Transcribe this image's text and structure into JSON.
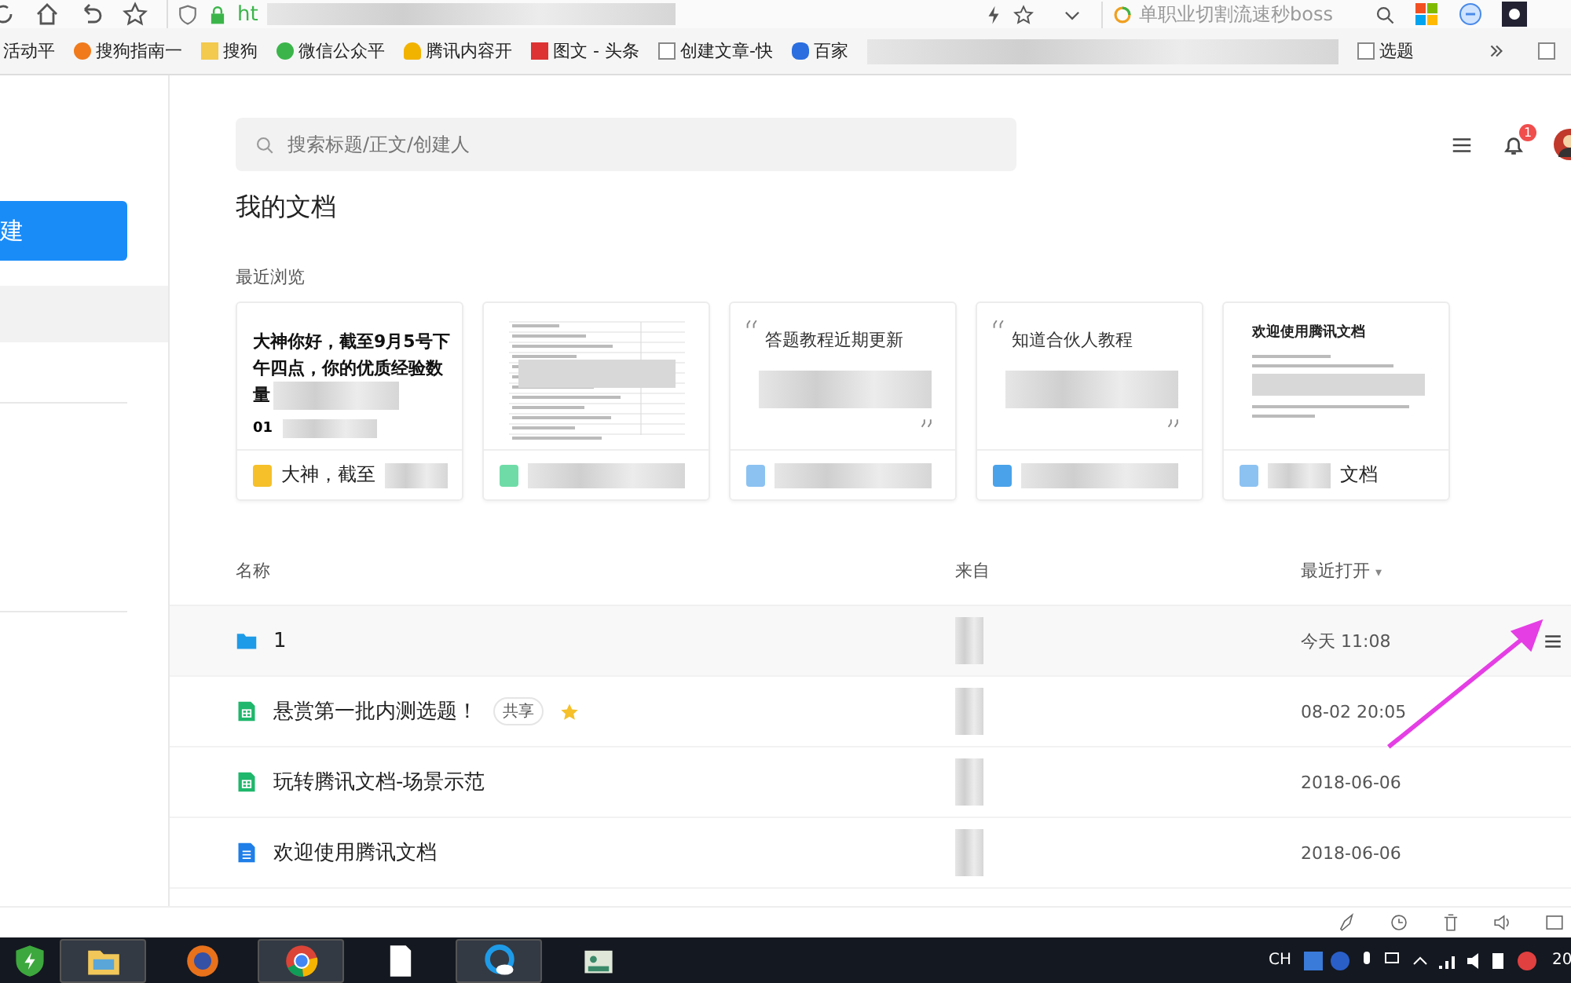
{
  "browser": {
    "url": "ht",
    "search": "单职业切割流速秒boss"
  },
  "bookmarks": [
    {
      "label": "活动平",
      "kind": "plain"
    },
    {
      "label": "搜狗指南一",
      "kind": "sogou"
    },
    {
      "label": "搜狗",
      "kind": "folder"
    },
    {
      "label": "微信公众平",
      "kind": "wechat"
    },
    {
      "label": "腾讯内容开",
      "kind": "bell"
    },
    {
      "label": "图文 - 头条",
      "kind": "toutiao"
    },
    {
      "label": "创建文章-快",
      "kind": "page"
    },
    {
      "label": "百家",
      "kind": "paw"
    },
    {
      "label": "选题",
      "kind": "page"
    }
  ],
  "sidebar": {
    "new_button": "建",
    "items": [
      {
        "selected": true
      }
    ]
  },
  "header": {
    "search_placeholder": "搜索标题/正文/创建人",
    "notification_count": "1"
  },
  "title": "我的文档",
  "recent": {
    "label": "最近浏览",
    "cards": [
      {
        "kind": "text",
        "preview_lines": [
          "大神你好，截至9月5号下",
          "午四点，你的优质经验数",
          "量"
        ],
        "footnote": "01",
        "name": "大神，截至",
        "color": "#f5c02a"
      },
      {
        "kind": "sheet",
        "color": "#6fdca8"
      },
      {
        "kind": "quote",
        "preview": "答题教程近期更新",
        "color": "#8cc2f2"
      },
      {
        "kind": "quote",
        "preview": "知道合伙人教程",
        "color": "#4aa2ea"
      },
      {
        "kind": "doc",
        "preview": "欢迎使用腾讯文档",
        "name": "文档",
        "color": "#8cc2f2"
      }
    ]
  },
  "table": {
    "columns": [
      "名称",
      "来自",
      "最近打开"
    ],
    "sort_indicator": "▾",
    "rows": [
      {
        "kind": "folder",
        "name": "1",
        "shared": false,
        "starred": false,
        "opened": "今天 11:08",
        "hovered": true
      },
      {
        "kind": "sheet",
        "name": "悬赏第一批内测选题！",
        "shared": true,
        "tag": "共享",
        "starred": true,
        "opened": "08-02 20:05",
        "hovered": false
      },
      {
        "kind": "sheet",
        "name": "玩转腾讯文档-场景示范",
        "shared": false,
        "starred": false,
        "opened": "2018-06-06",
        "hovered": false
      },
      {
        "kind": "doc",
        "name": "欢迎使用腾讯文档",
        "shared": false,
        "starred": false,
        "opened": "2018-06-06",
        "hovered": false
      }
    ]
  },
  "taskbar": {
    "language": "CH",
    "clock": "20"
  }
}
